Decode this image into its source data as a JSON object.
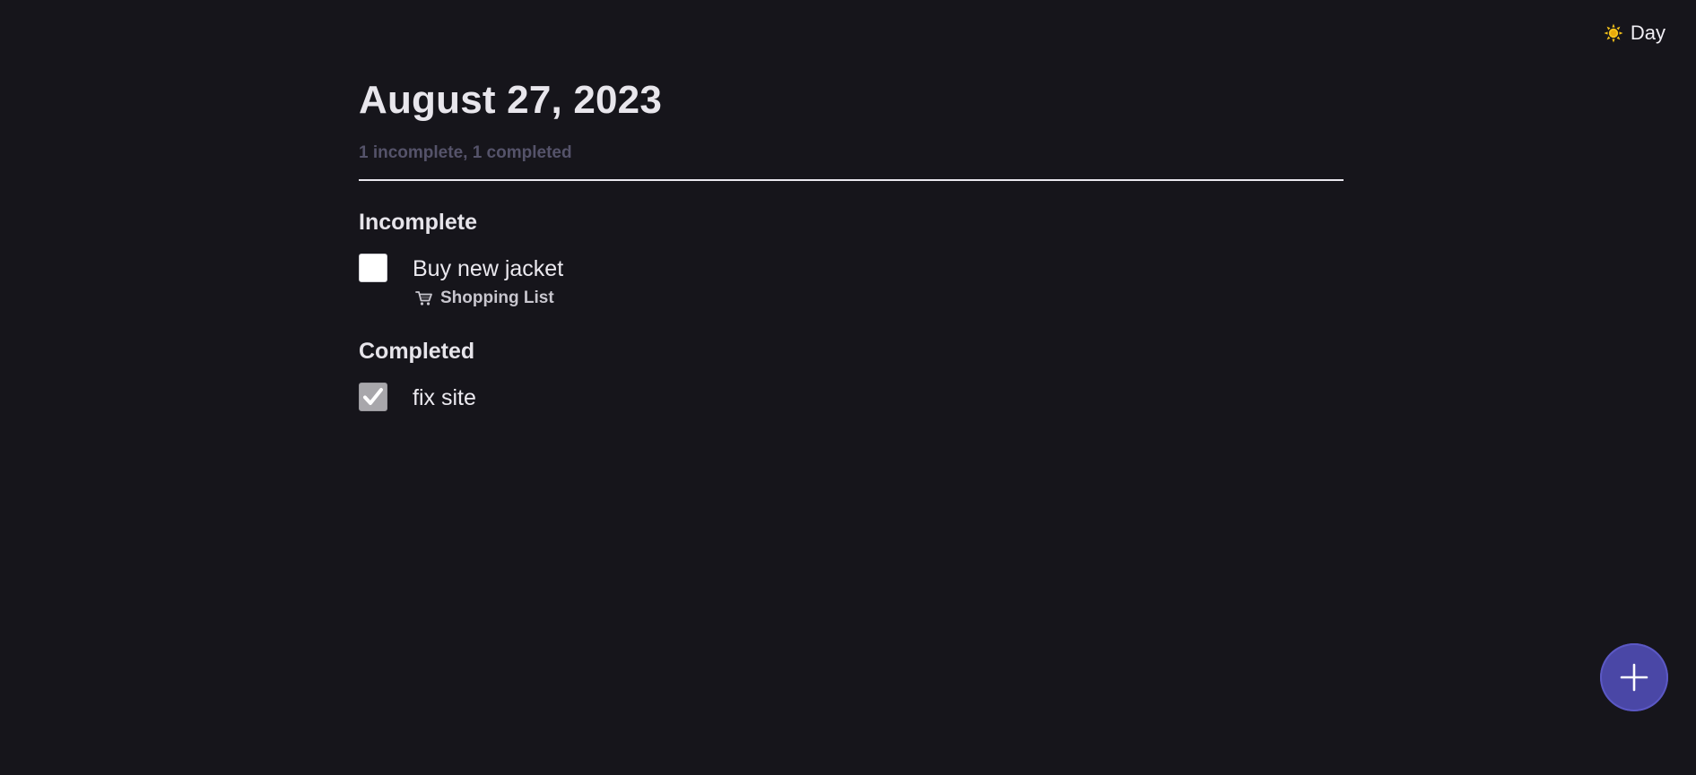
{
  "header": {
    "theme_label": "Day",
    "theme_icon": "sun-icon"
  },
  "page": {
    "title": "August 27, 2023",
    "summary": "1 incomplete, 1 completed"
  },
  "sections": {
    "incomplete": {
      "title": "Incomplete",
      "tasks": [
        {
          "label": "Buy new jacket",
          "checked": false,
          "list": {
            "icon": "shopping-cart-icon",
            "name": "Shopping List"
          }
        }
      ]
    },
    "completed": {
      "title": "Completed",
      "tasks": [
        {
          "label": "fix site",
          "checked": true
        }
      ]
    }
  },
  "fab": {
    "icon": "plus-icon"
  },
  "colors": {
    "background": "#16151b",
    "fab": "#4a47a6",
    "summary_text": "#55536a",
    "sun": "#f4c21a"
  }
}
